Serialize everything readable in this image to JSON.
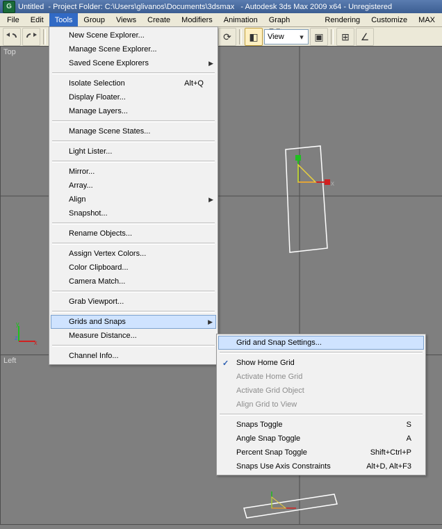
{
  "title": {
    "doc": "Untitled",
    "folder_label": "- Project Folder:",
    "folder_path": "C:\\Users\\glivanos\\Documents\\3dsmax",
    "app": "- Autodesk 3ds Max  2009 x64  -",
    "reg": "Unregistered"
  },
  "menubar": {
    "items": [
      "File",
      "Edit",
      "Tools",
      "Group",
      "Views",
      "Create",
      "Modifiers",
      "Animation",
      "Graph Editors",
      "Rendering",
      "Customize",
      "MAX"
    ],
    "active_index": 2
  },
  "toolbar": {
    "view_label": "View",
    "icons": [
      "undo",
      "redo",
      "link",
      "unlink",
      "bind",
      "sel-rect",
      "sel-name",
      "sel-window",
      "sel-cross",
      "move",
      "rotate",
      "scale-pressed",
      "ref",
      "snap",
      "render"
    ]
  },
  "viewports": {
    "top_label": "Top",
    "left_label": "Left"
  },
  "tools_menu": {
    "items": [
      {
        "label": "New Scene Explorer..."
      },
      {
        "label": "Manage Scene Explorer..."
      },
      {
        "label": "Saved Scene Explorers",
        "submenu": true
      },
      {
        "sep": true
      },
      {
        "label": "Isolate Selection",
        "shortcut": "Alt+Q"
      },
      {
        "label": "Display Floater..."
      },
      {
        "label": "Manage Layers..."
      },
      {
        "sep": true
      },
      {
        "label": "Manage Scene States..."
      },
      {
        "sep": true
      },
      {
        "label": "Light Lister..."
      },
      {
        "sep": true
      },
      {
        "label": "Mirror..."
      },
      {
        "label": "Array..."
      },
      {
        "label": "Align",
        "submenu": true
      },
      {
        "label": "Snapshot..."
      },
      {
        "sep": true
      },
      {
        "label": "Rename Objects..."
      },
      {
        "sep": true
      },
      {
        "label": "Assign Vertex Colors..."
      },
      {
        "label": "Color Clipboard..."
      },
      {
        "label": "Camera Match..."
      },
      {
        "sep": true
      },
      {
        "label": "Grab Viewport..."
      },
      {
        "sep": true
      },
      {
        "label": "Grids and Snaps",
        "submenu": true,
        "hover": true
      },
      {
        "label": "Measure Distance..."
      },
      {
        "sep": true
      },
      {
        "label": "Channel Info..."
      }
    ]
  },
  "grids_submenu": {
    "items": [
      {
        "label": "Grid and Snap Settings...",
        "hover": true
      },
      {
        "sep": true
      },
      {
        "label": "Show Home Grid",
        "checked": true
      },
      {
        "label": "Activate Home Grid",
        "disabled": true
      },
      {
        "label": "Activate Grid Object",
        "disabled": true
      },
      {
        "label": "Align Grid to View",
        "disabled": true
      },
      {
        "sep": true
      },
      {
        "label": "Snaps Toggle",
        "shortcut": "S"
      },
      {
        "label": "Angle Snap Toggle",
        "shortcut": "A"
      },
      {
        "label": "Percent Snap Toggle",
        "shortcut": "Shift+Ctrl+P"
      },
      {
        "label": "Snaps Use Axis Constraints",
        "shortcut": "Alt+D, Alt+F3"
      }
    ]
  },
  "axes": {
    "x": "x",
    "y": "y",
    "z": "z"
  }
}
